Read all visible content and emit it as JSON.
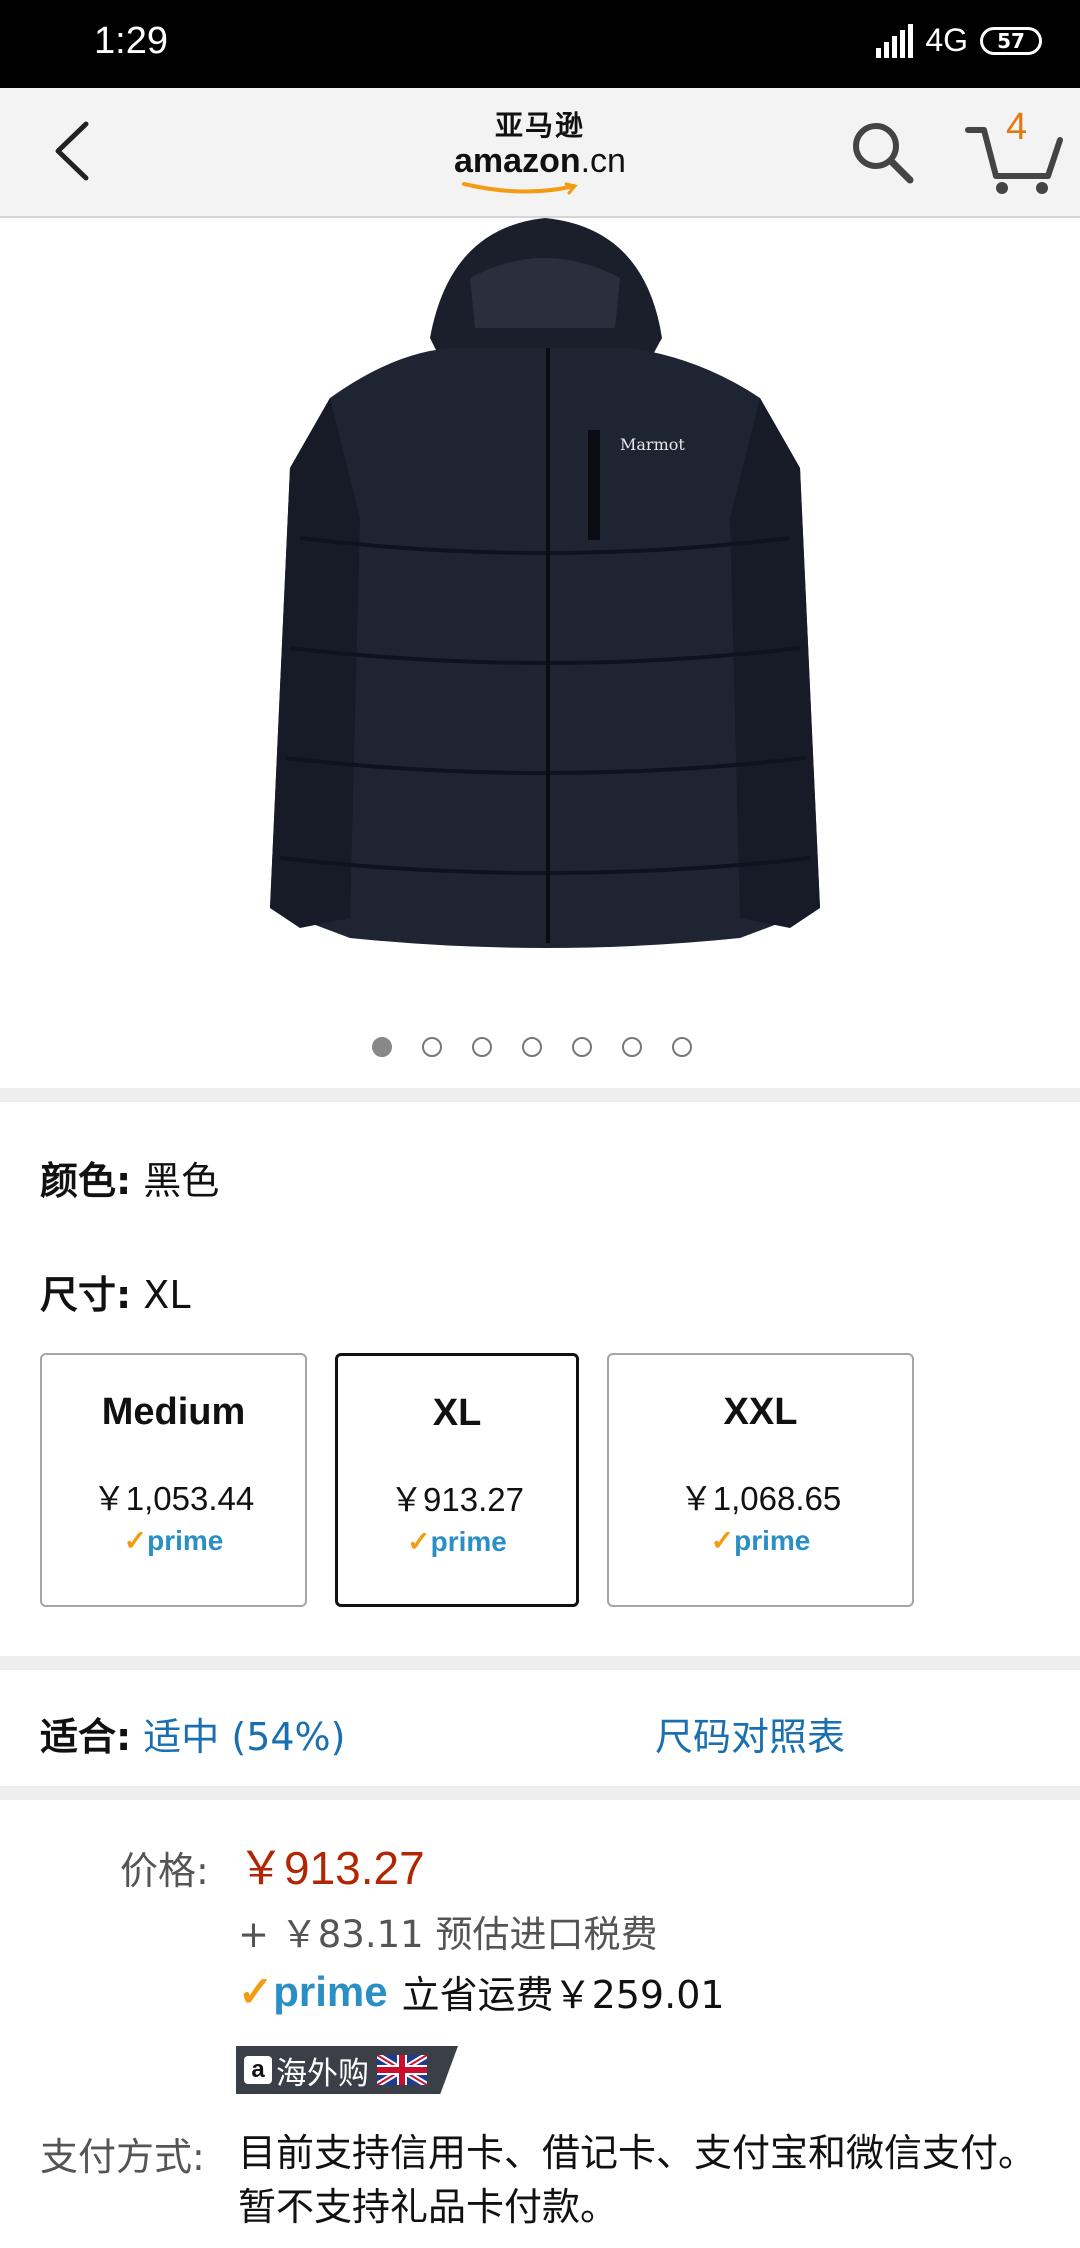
{
  "status_bar": {
    "time": "1:29",
    "network": "4G",
    "battery": "57"
  },
  "header": {
    "logo_cn": "亚马逊",
    "logo_en": "amazon",
    "logo_suffix": ".cn",
    "cart_count": "4"
  },
  "product": {
    "image_count": 7,
    "active_image": 1,
    "brand_on_image": "Marmot",
    "colors": {
      "jacket": "#1f2433",
      "jacket_shade": "#141826",
      "price": "#b12704",
      "link": "#1a6fb0",
      "prime_blue": "#2a8fc5",
      "prime_check": "#f39c12"
    }
  },
  "color_row": {
    "label": "颜色:",
    "value": "黑色"
  },
  "size_row": {
    "label": "尺寸:",
    "value": "XL"
  },
  "sizes": [
    {
      "name": "Medium",
      "price": "￥1,053.44",
      "prime": "prime"
    },
    {
      "name": "XL",
      "price": "￥913.27",
      "prime": "prime",
      "selected": true
    },
    {
      "name": "XXL",
      "price": "￥1,068.65",
      "prime": "prime"
    }
  ],
  "fit": {
    "label": "适合:",
    "value": "适中 (54%)",
    "chart_link": "尺码对照表"
  },
  "pricing": {
    "label": "价格:",
    "price": "￥913.27",
    "tax": "+ ￥83.11 预估进口税费",
    "prime_label": "prime",
    "prime_saving": "立省运费￥259.01",
    "badge_text": "海外购"
  },
  "payment": {
    "label": "支付方式:",
    "text": "目前支持信用卡、借记卡、支付宝和微信支付。暂不支持礼品卡付款。"
  }
}
